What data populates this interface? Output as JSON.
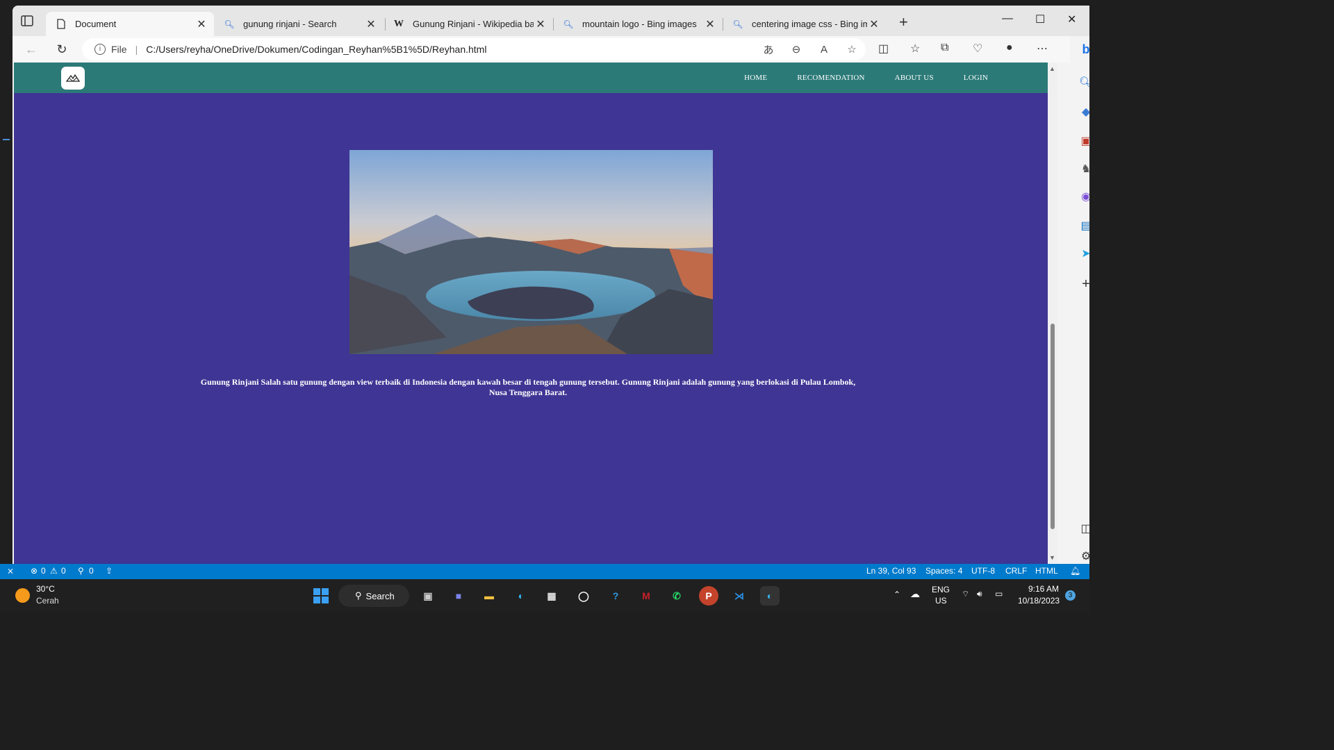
{
  "browser": {
    "tabs": [
      {
        "label": "Document",
        "icon": "page-icon",
        "active": true
      },
      {
        "label": "gunung rinjani - Search",
        "icon": "search-icon"
      },
      {
        "label": "Gunung Rinjani - Wikipedia baha",
        "icon": "wikipedia-icon"
      },
      {
        "label": "mountain logo - Bing images",
        "icon": "search-icon"
      },
      {
        "label": "centering image css - Bing image",
        "icon": "search-icon"
      }
    ],
    "address": {
      "scheme_label": "File",
      "url": "C:/Users/reyha/OneDrive/Dokumen/Codingan_Reyhan%5B1%5D/Reyhan.html"
    }
  },
  "site": {
    "menu": [
      "HOME",
      "RECOMENDATION",
      "ABOUT US",
      "LOGIN"
    ],
    "caption": "Gunung Rinjani Salah satu gunung dengan view terbaik di Indonesia dengan kawah besar di tengah gunung tersebut. Gunung Rinjani adalah gunung yang berlokasi di Pulau Lombok, Nusa Tenggara Barat.",
    "colors": {
      "navbar": "#2b7a78",
      "background": "#3f3594",
      "text": "#ffffff"
    }
  },
  "statusbar": {
    "errors": "0",
    "warnings": "0",
    "ports": "0",
    "position": "Ln 39, Col 93",
    "spaces": "Spaces: 4",
    "encoding": "UTF-8",
    "eol": "CRLF",
    "language": "HTML"
  },
  "taskbar": {
    "weather_temp": "30°C",
    "weather_desc": "Cerah",
    "search_label": "Search",
    "lang_top": "ENG",
    "lang_bottom": "US",
    "time": "9:16 AM",
    "date": "10/18/2023",
    "notification_count": "3"
  }
}
